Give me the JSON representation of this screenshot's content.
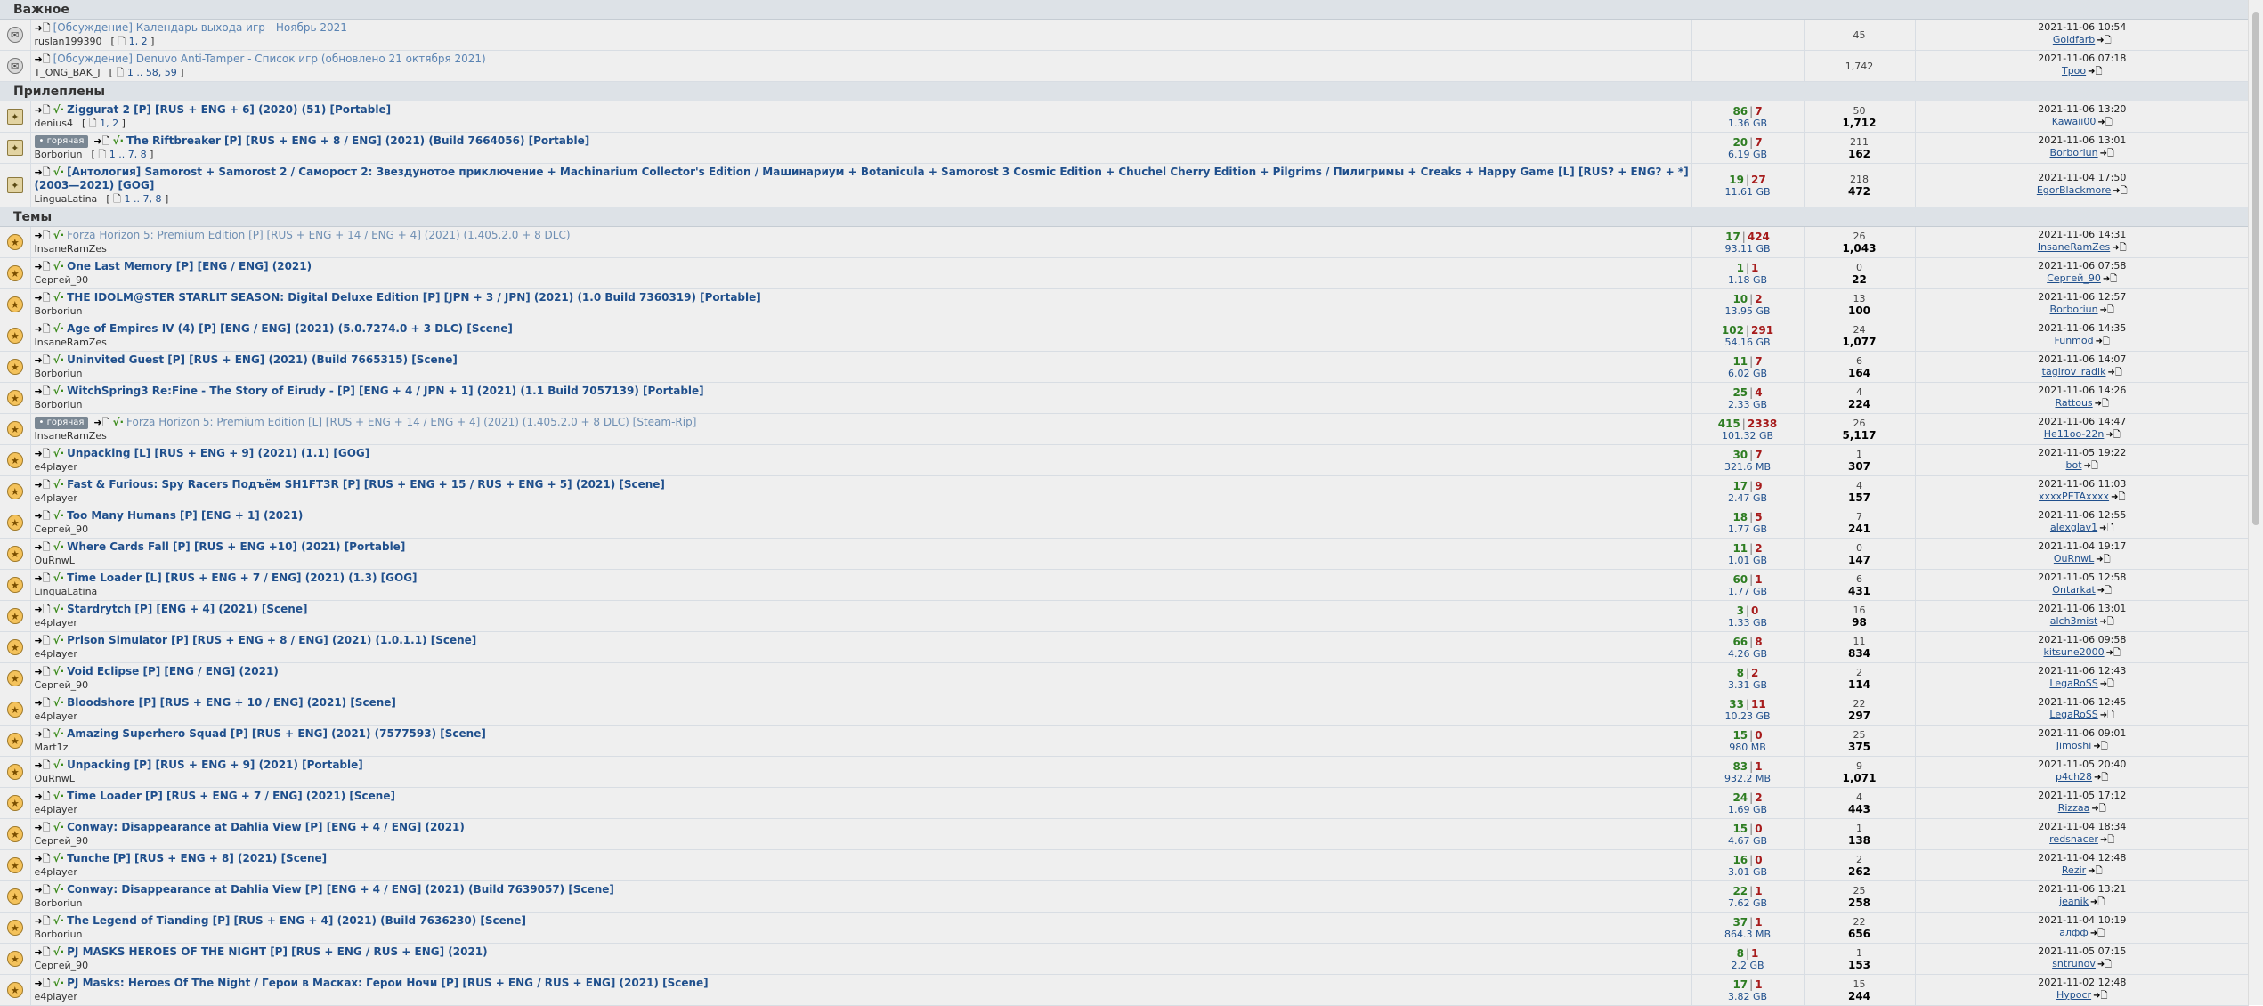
{
  "sections": [
    {
      "title": "Важное",
      "topics": [
        {
          "icon": "announcement-icon",
          "icon_glyph": "✉",
          "hot": false,
          "check": false,
          "style": "announce",
          "title": "[Обсуждение] Календарь выхода игр - Ноябрь 2021",
          "author": "ruslan199390",
          "pages": "1, 2",
          "seeds": "",
          "leeches": "",
          "size": "",
          "replies": "",
          "views": "45",
          "date": "2021-11-06 10:54",
          "last_user": "Goldfarb"
        },
        {
          "icon": "announcement-icon",
          "icon_glyph": "✉",
          "hot": false,
          "check": false,
          "style": "announce",
          "title": "[Обсуждение] Denuvo Anti-Tamper - Список игр (обновлено 21 октября 2021)",
          "author": "T_ONG_BAK_J",
          "pages": "1 .. 58, 59",
          "seeds": "",
          "leeches": "",
          "size": "",
          "replies": "",
          "views": "1,742",
          "date": "2021-11-06 07:18",
          "last_user": "Tpoo"
        }
      ]
    },
    {
      "title": "Прилеплены",
      "topics": [
        {
          "icon": "sticky-icon",
          "icon_glyph": "✦",
          "hot": false,
          "check": true,
          "style": "",
          "title": "Ziggurat 2 [P] [RUS + ENG + 6] (2020) (51) [Portable]",
          "author": "denius4",
          "pages": "1, 2",
          "seeds": "86",
          "leeches": "7",
          "size": "1.36 GB",
          "replies": "50",
          "views": "1,712",
          "date": "2021-11-06 13:20",
          "last_user": "Kawaii00"
        },
        {
          "icon": "sticky-icon",
          "icon_glyph": "✦",
          "hot": true,
          "check": true,
          "style": "",
          "title": "The Riftbreaker [P] [RUS + ENG + 8 / ENG] (2021) (Build 7664056) [Portable]",
          "author": "Borboriun",
          "pages": "1 .. 7, 8",
          "seeds": "20",
          "leeches": "7",
          "size": "6.19 GB",
          "replies": "211",
          "views": "162",
          "date": "2021-11-06 13:01",
          "last_user": "Borboriun"
        },
        {
          "icon": "sticky-icon",
          "icon_glyph": "✦",
          "hot": false,
          "check": true,
          "style": "",
          "title": "[Антология] Samorost + Samorost 2 / Саморост 2: Звездунотое приключение + Machinarium Collector's Edition / Машинариум + Botanicula + Samorost 3 Cosmic Edition + Chuchel Cherry Edition + Pilgrims / Пилигримы + Creaks + Happy Game [L] [RUS? + ENG? + *] (2003—2021) [GOG]",
          "author": "LinguaLatina",
          "pages": "1 .. 7, 8",
          "seeds": "19",
          "leeches": "27",
          "size": "11.61 GB",
          "replies": "218",
          "views": "472",
          "date": "2021-11-04 17:50",
          "last_user": "EgorBlackmore"
        }
      ]
    },
    {
      "title": "Темы",
      "topics": [
        {
          "icon": "topic-star-icon",
          "icon_glyph": "★",
          "hot": false,
          "check": true,
          "style": "visited",
          "title": "Forza Horizon 5: Premium Edition [P] [RUS + ENG + 14 / ENG + 4] (2021) (1.405.2.0 + 8 DLC)",
          "author": "InsaneRamZes",
          "pages": "",
          "seeds": "17",
          "leeches": "424",
          "size": "93.11 GB",
          "replies": "26",
          "views": "1,043",
          "date": "2021-11-06 14:31",
          "last_user": "InsaneRamZes"
        },
        {
          "icon": "topic-star-icon",
          "icon_glyph": "★",
          "hot": false,
          "check": true,
          "style": "",
          "title": "One Last Memory [P] [ENG / ENG] (2021)",
          "author": "Сергей_90",
          "pages": "",
          "seeds": "1",
          "leeches": "1",
          "size": "1.18 GB",
          "replies": "0",
          "views": "22",
          "date": "2021-11-06 07:58",
          "last_user": "Сергей_90"
        },
        {
          "icon": "topic-star-icon",
          "icon_glyph": "★",
          "hot": false,
          "check": true,
          "style": "",
          "title": "THE IDOLM@STER STARLIT SEASON: Digital Deluxe Edition [P] [JPN + 3 / JPN] (2021) (1.0 Build 7360319) [Portable]",
          "author": "Borboriun",
          "pages": "",
          "seeds": "10",
          "leeches": "2",
          "size": "13.95 GB",
          "replies": "13",
          "views": "100",
          "date": "2021-11-06 12:57",
          "last_user": "Borboriun"
        },
        {
          "icon": "topic-star-icon",
          "icon_glyph": "★",
          "hot": false,
          "check": true,
          "style": "",
          "title": "Age of Empires IV (4) [P] [ENG / ENG] (2021) (5.0.7274.0 + 3 DLC) [Scene]",
          "author": "InsaneRamZes",
          "pages": "",
          "seeds": "102",
          "leeches": "291",
          "size": "54.16 GB",
          "replies": "24",
          "views": "1,077",
          "date": "2021-11-06 14:35",
          "last_user": "Funmod"
        },
        {
          "icon": "topic-star-icon",
          "icon_glyph": "★",
          "hot": false,
          "check": true,
          "style": "",
          "title": "Uninvited Guest [P] [RUS + ENG] (2021) (Build 7665315) [Scene]",
          "author": "Borboriun",
          "pages": "",
          "seeds": "11",
          "leeches": "7",
          "size": "6.02 GB",
          "replies": "6",
          "views": "164",
          "date": "2021-11-06 14:07",
          "last_user": "tagirov_radik"
        },
        {
          "icon": "topic-star-icon",
          "icon_glyph": "★",
          "hot": false,
          "check": true,
          "style": "",
          "title": "WitchSpring3 Re:Fine - The Story of Eirudy - [P] [ENG + 4 / JPN + 1] (2021) (1.1 Build 7057139) [Portable]",
          "author": "Borboriun",
          "pages": "",
          "seeds": "25",
          "leeches": "4",
          "size": "2.33 GB",
          "replies": "4",
          "views": "224",
          "date": "2021-11-06 14:26",
          "last_user": "Rattous"
        },
        {
          "icon": "topic-star-icon",
          "icon_glyph": "★",
          "hot": true,
          "check": true,
          "style": "visited",
          "title": "Forza Horizon 5: Premium Edition [L] [RUS + ENG + 14 / ENG + 4] (2021) (1.405.2.0 + 8 DLC) [Steam-Rip]",
          "author": "InsaneRamZes",
          "pages": "",
          "seeds": "415",
          "leeches": "2338",
          "size": "101.32 GB",
          "replies": "26",
          "views": "5,117",
          "date": "2021-11-06 14:47",
          "last_user": "He11oo-22n"
        },
        {
          "icon": "topic-star-icon",
          "icon_glyph": "★",
          "hot": false,
          "check": true,
          "style": "",
          "title": "Unpacking [L] [RUS + ENG + 9] (2021) (1.1) [GOG]",
          "author": "e4player",
          "pages": "",
          "seeds": "30",
          "leeches": "7",
          "size": "321.6 MB",
          "replies": "1",
          "views": "307",
          "date": "2021-11-05 19:22",
          "last_user": "bot"
        },
        {
          "icon": "topic-star-icon",
          "icon_glyph": "★",
          "hot": false,
          "check": true,
          "style": "",
          "title": "Fast & Furious: Spy Racers Подъём SH1FT3R [P] [RUS + ENG + 15 / RUS + ENG + 5] (2021) [Scene]",
          "author": "e4player",
          "pages": "",
          "seeds": "17",
          "leeches": "9",
          "size": "2.47 GB",
          "replies": "4",
          "views": "157",
          "date": "2021-11-06 11:03",
          "last_user": "xxxxPETAxxxx"
        },
        {
          "icon": "topic-star-icon",
          "icon_glyph": "★",
          "hot": false,
          "check": true,
          "style": "",
          "title": "Too Many Humans [P] [ENG + 1] (2021)",
          "author": "Сергей_90",
          "pages": "",
          "seeds": "18",
          "leeches": "5",
          "size": "1.77 GB",
          "replies": "7",
          "views": "241",
          "date": "2021-11-06 12:55",
          "last_user": "alexglav1"
        },
        {
          "icon": "topic-star-icon",
          "icon_glyph": "★",
          "hot": false,
          "check": true,
          "style": "",
          "title": "Where Cards Fall [P] [RUS + ENG +10] (2021) [Portable]",
          "author": "OuRnwL",
          "pages": "",
          "seeds": "11",
          "leeches": "2",
          "size": "1.01 GB",
          "replies": "0",
          "views": "147",
          "date": "2021-11-04 19:17",
          "last_user": "OuRnwL"
        },
        {
          "icon": "topic-star-icon",
          "icon_glyph": "★",
          "hot": false,
          "check": true,
          "style": "",
          "title": "Time Loader [L] [RUS + ENG + 7 / ENG] (2021) (1.3) [GOG]",
          "author": "LinguaLatina",
          "pages": "",
          "seeds": "60",
          "leeches": "1",
          "size": "1.77 GB",
          "replies": "6",
          "views": "431",
          "date": "2021-11-05 12:58",
          "last_user": "Ontarkat"
        },
        {
          "icon": "topic-star-icon",
          "icon_glyph": "★",
          "hot": false,
          "check": true,
          "style": "",
          "title": "Stardrytch [P] [ENG + 4] (2021) [Scene]",
          "author": "e4player",
          "pages": "",
          "seeds": "3",
          "leeches": "0",
          "size": "1.33 GB",
          "replies": "16",
          "views": "98",
          "date": "2021-11-06 13:01",
          "last_user": "alch3mist"
        },
        {
          "icon": "topic-star-icon",
          "icon_glyph": "★",
          "hot": false,
          "check": true,
          "style": "",
          "title": "Prison Simulator [P] [RUS + ENG + 8 / ENG] (2021) (1.0.1.1) [Scene]",
          "author": "e4player",
          "pages": "",
          "seeds": "66",
          "leeches": "8",
          "size": "4.26 GB",
          "replies": "11",
          "views": "834",
          "date": "2021-11-06 09:58",
          "last_user": "kitsune2000"
        },
        {
          "icon": "topic-star-icon",
          "icon_glyph": "★",
          "hot": false,
          "check": true,
          "style": "",
          "title": "Void Eclipse [P] [ENG / ENG] (2021)",
          "author": "Сергей_90",
          "pages": "",
          "seeds": "8",
          "leeches": "2",
          "size": "3.31 GB",
          "replies": "2",
          "views": "114",
          "date": "2021-11-06 12:43",
          "last_user": "LegaRoSS"
        },
        {
          "icon": "topic-star-icon",
          "icon_glyph": "★",
          "hot": false,
          "check": true,
          "style": "",
          "title": "Bloodshore [P] [RUS + ENG + 10 / ENG] (2021) [Scene]",
          "author": "e4player",
          "pages": "",
          "seeds": "33",
          "leeches": "11",
          "size": "10.23 GB",
          "replies": "22",
          "views": "297",
          "date": "2021-11-06 12:45",
          "last_user": "LegaRoSS"
        },
        {
          "icon": "topic-star-icon",
          "icon_glyph": "★",
          "hot": false,
          "check": true,
          "style": "",
          "title": "Amazing Superhero Squad [P] [RUS + ENG] (2021) (7577593) [Scene]",
          "author": "Mart1z",
          "pages": "",
          "seeds": "15",
          "leeches": "0",
          "size": "980 MB",
          "replies": "25",
          "views": "375",
          "date": "2021-11-06 09:01",
          "last_user": "Jimoshi"
        },
        {
          "icon": "topic-star-icon",
          "icon_glyph": "★",
          "hot": false,
          "check": true,
          "style": "",
          "title": "Unpacking [P] [RUS + ENG + 9] (2021) [Portable]",
          "author": "OuRnwL",
          "pages": "",
          "seeds": "83",
          "leeches": "1",
          "size": "932.2 MB",
          "replies": "9",
          "views": "1,071",
          "date": "2021-11-05 20:40",
          "last_user": "p4ch28"
        },
        {
          "icon": "topic-star-icon",
          "icon_glyph": "★",
          "hot": false,
          "check": true,
          "style": "",
          "title": "Time Loader [P] [RUS + ENG + 7 / ENG] (2021) [Scene]",
          "author": "e4player",
          "pages": "",
          "seeds": "24",
          "leeches": "2",
          "size": "1.69 GB",
          "replies": "4",
          "views": "443",
          "date": "2021-11-05 17:12",
          "last_user": "Rizzaa"
        },
        {
          "icon": "topic-star-icon",
          "icon_glyph": "★",
          "hot": false,
          "check": true,
          "style": "",
          "title": "Conway: Disappearance at Dahlia View [P] [ENG + 4 / ENG] (2021)",
          "author": "Сергей_90",
          "pages": "",
          "seeds": "15",
          "leeches": "0",
          "size": "4.67 GB",
          "replies": "1",
          "views": "138",
          "date": "2021-11-04 18:34",
          "last_user": "redsnacer"
        },
        {
          "icon": "topic-star-icon",
          "icon_glyph": "★",
          "hot": false,
          "check": true,
          "style": "",
          "title": "Tunche [P] [RUS + ENG + 8] (2021) [Scene]",
          "author": "e4player",
          "pages": "",
          "seeds": "16",
          "leeches": "0",
          "size": "3.01 GB",
          "replies": "2",
          "views": "262",
          "date": "2021-11-04 12:48",
          "last_user": "Rezir"
        },
        {
          "icon": "topic-star-icon",
          "icon_glyph": "★",
          "hot": false,
          "check": true,
          "style": "",
          "title": "Conway: Disappearance at Dahlia View [P] [ENG + 4 / ENG] (2021) (Build 7639057) [Scene]",
          "author": "Borboriun",
          "pages": "",
          "seeds": "22",
          "leeches": "1",
          "size": "7.62 GB",
          "replies": "25",
          "views": "258",
          "date": "2021-11-06 13:21",
          "last_user": "jeanik"
        },
        {
          "icon": "topic-star-icon",
          "icon_glyph": "★",
          "hot": false,
          "check": true,
          "style": "",
          "title": "The Legend of Tianding [P] [RUS + ENG + 4] (2021) (Build 7636230) [Scene]",
          "author": "Borboriun",
          "pages": "",
          "seeds": "37",
          "leeches": "1",
          "size": "864.3 MB",
          "replies": "22",
          "views": "656",
          "date": "2021-11-04 10:19",
          "last_user": "алфф"
        },
        {
          "icon": "topic-star-icon",
          "icon_glyph": "★",
          "hot": false,
          "check": true,
          "style": "",
          "title": "PJ MASKS HEROES OF THE NIGHT [P] [RUS + ENG / RUS + ENG] (2021)",
          "author": "Сергей_90",
          "pages": "",
          "seeds": "8",
          "leeches": "1",
          "size": "2.2 GB",
          "replies": "1",
          "views": "153",
          "date": "2021-11-05 07:15",
          "last_user": "sntrunov"
        },
        {
          "icon": "topic-star-icon",
          "icon_glyph": "★",
          "hot": false,
          "check": true,
          "style": "",
          "title": "PJ Masks: Heroes Of The Night / Герои в Масках: Герои Ночи [P] [RUS + ENG / RUS + ENG] (2021) [Scene]",
          "author": "e4player",
          "pages": "",
          "seeds": "17",
          "leeches": "1",
          "size": "3.82 GB",
          "replies": "15",
          "views": "244",
          "date": "2021-11-02 12:48",
          "last_user": "Hypocr"
        }
      ]
    }
  ],
  "labels": {
    "hot_badge": "• горячая",
    "download_glyph": "➜🗋",
    "check_glyph": "√·",
    "goto_glyph": "➜🗋",
    "page_glyph": "🗋",
    "seed_sep": "|"
  },
  "colors": {
    "section_bg": "#dde2e7",
    "row_bg": "#efefef",
    "link": "#1f4f8c",
    "seeds": "#2e7d22",
    "leeches": "#a61b1b"
  }
}
